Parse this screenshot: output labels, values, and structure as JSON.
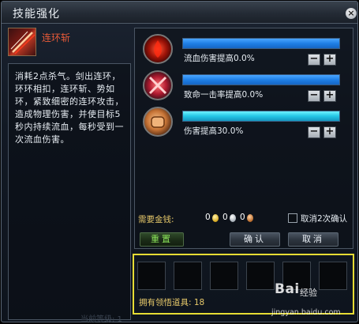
{
  "window": {
    "title": "技能强化",
    "close_label": "×"
  },
  "skill": {
    "name": "连环斩",
    "description": "消耗2点杀气。剑出连环，环环相扣，连环斩、势如环，紧致细密的连环攻击，造成物理伤害，并使目标5秒内持续流血，每秒受到一次流血伤害。",
    "faded_text": "当前等级: 1"
  },
  "attributes": [
    {
      "label": "流血伤害提高0.0%",
      "icon": "bleed-icon",
      "fill": 1.0,
      "bar_color": "#1f7fe6"
    },
    {
      "label": "致命一击率提高0.0%",
      "icon": "crit-icon",
      "fill": 1.0,
      "bar_color": "#1f7fe6"
    },
    {
      "label": "伤害提高30.0%",
      "icon": "damage-icon",
      "fill": 1.0,
      "bar_color": "#24c6e6"
    }
  ],
  "stepper": {
    "minus": "−",
    "plus": "+"
  },
  "money": {
    "label": "需要金钱:",
    "gold": "0",
    "silver": "0",
    "copper": "0"
  },
  "checkbox": {
    "label": "取消2次确认",
    "checked": false
  },
  "buttons": {
    "reset": "重置",
    "confirm": "确认",
    "cancel": "取消"
  },
  "items": {
    "count_label": "拥有领悟道具: 18",
    "slots": 6
  },
  "watermark": {
    "brand": "Bai",
    "sub": "经验",
    "url": "jingyan.baidu.com"
  }
}
